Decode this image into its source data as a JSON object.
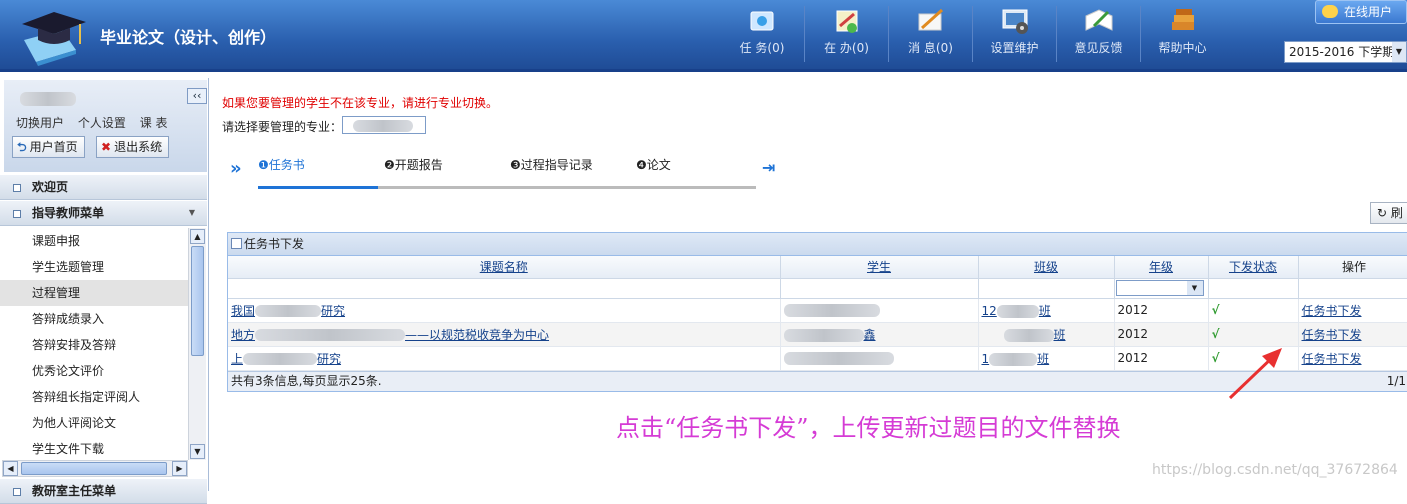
{
  "header": {
    "title": "毕业论文（设计、创作）",
    "tools": [
      {
        "label": "任 务(0)",
        "icon": "task-icon"
      },
      {
        "label": "在 办(0)",
        "icon": "in-progress-icon"
      },
      {
        "label": "消 息(0)",
        "icon": "message-icon"
      },
      {
        "label": "设置维护",
        "icon": "settings-monitor-icon"
      },
      {
        "label": "意见反馈",
        "icon": "feedback-icon"
      },
      {
        "label": "帮助中心",
        "icon": "help-books-icon"
      }
    ],
    "online_users": "在线用户",
    "semester": "2015-2016 下学期"
  },
  "sidebar": {
    "user_links": [
      "切换用户",
      "个人设置",
      "课 表"
    ],
    "home_button": "用户首页",
    "logout_button": "退出系统",
    "welcome": "欢迎页",
    "teacher_menu": "指导教师菜单",
    "items": [
      "课题申报",
      "学生选题管理",
      "过程管理",
      "答辩成绩录入",
      "答辩安排及答辩",
      "优秀论文评价",
      "答辩组长指定评阅人",
      "为他人评阅论文",
      "学生文件下载"
    ],
    "active_index": 2,
    "bottom_menu": "教研室主任菜单"
  },
  "main": {
    "notice": "如果您要管理的学生不在该专业，请进行专业切换。",
    "major_label": "请选择要管理的专业：",
    "steps": [
      "任务书",
      "开题报告",
      "过程指导记录",
      "论文"
    ],
    "step_markers": [
      "❶",
      "❷",
      "❸",
      "❹"
    ],
    "refresh_label": "刷",
    "grid_title": "任务书下发",
    "columns": [
      "课题名称",
      "学生",
      "班级",
      "年级",
      "下发状态",
      "操作"
    ],
    "rows": [
      {
        "title": "我国",
        "title2": "研究",
        "student": "",
        "class1": "12",
        "class2": "班",
        "grade": "2012",
        "status": "√",
        "action": "任务书下发"
      },
      {
        "title": "地方",
        "title2": "——以规范税收竞争为中心",
        "student": "鑫",
        "class1": "",
        "class2": "班",
        "grade": "2012",
        "status": "√",
        "action": "任务书下发"
      },
      {
        "title": "上",
        "title2": "研究",
        "student": "",
        "class1": "1",
        "class2": "班",
        "grade": "2012",
        "status": "√",
        "action": "任务书下发"
      }
    ],
    "footer": "共有3条信息,每页显示25条.",
    "page": "1/1"
  },
  "annotation": "点击“任务书下发”，上传更新过题目的文件替换",
  "watermark": "https://blog.csdn.net/qq_37672864",
  "colors": {
    "header": "#2a5fae",
    "notice": "#e00000",
    "annotation": "#d53bd5",
    "accent": "#1e73d6"
  }
}
